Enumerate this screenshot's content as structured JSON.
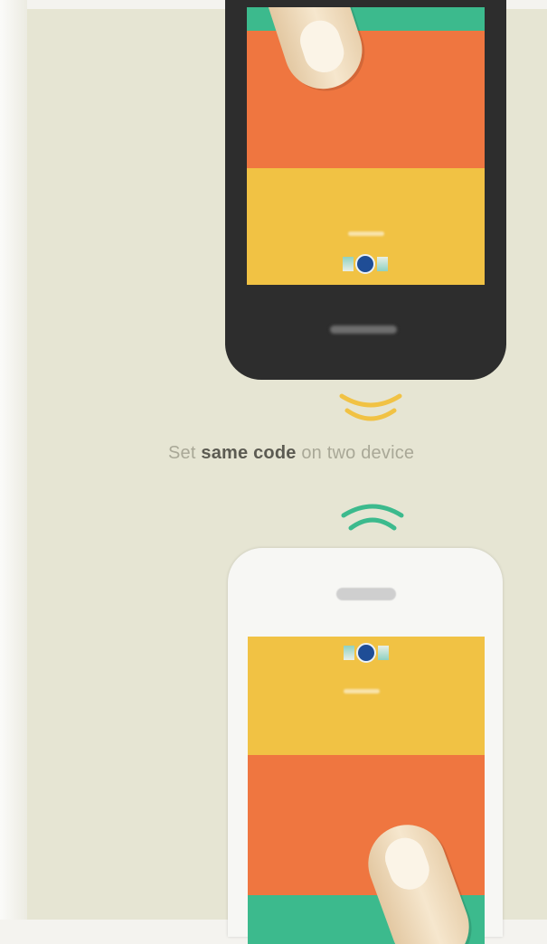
{
  "caption": {
    "prefix": "Set ",
    "emphasis": "same code",
    "suffix": " on two device"
  },
  "colors": {
    "background": "#e6e5d3",
    "top_phone_body": "#2d2d2d",
    "bottom_phone_body": "#f7f7f4",
    "screen_green": "#3cba8d",
    "screen_orange": "#ef7640",
    "screen_yellow": "#f1c244",
    "code_dot": "#1f4d96",
    "wave_top": "#f1c244",
    "wave_bottom": "#3cba8d"
  },
  "icons": {
    "top_wave": "signal-waves-down-icon",
    "bottom_wave": "signal-waves-up-icon",
    "code_marker": "code-dot-icon",
    "finger": "finger-tap-icon"
  }
}
